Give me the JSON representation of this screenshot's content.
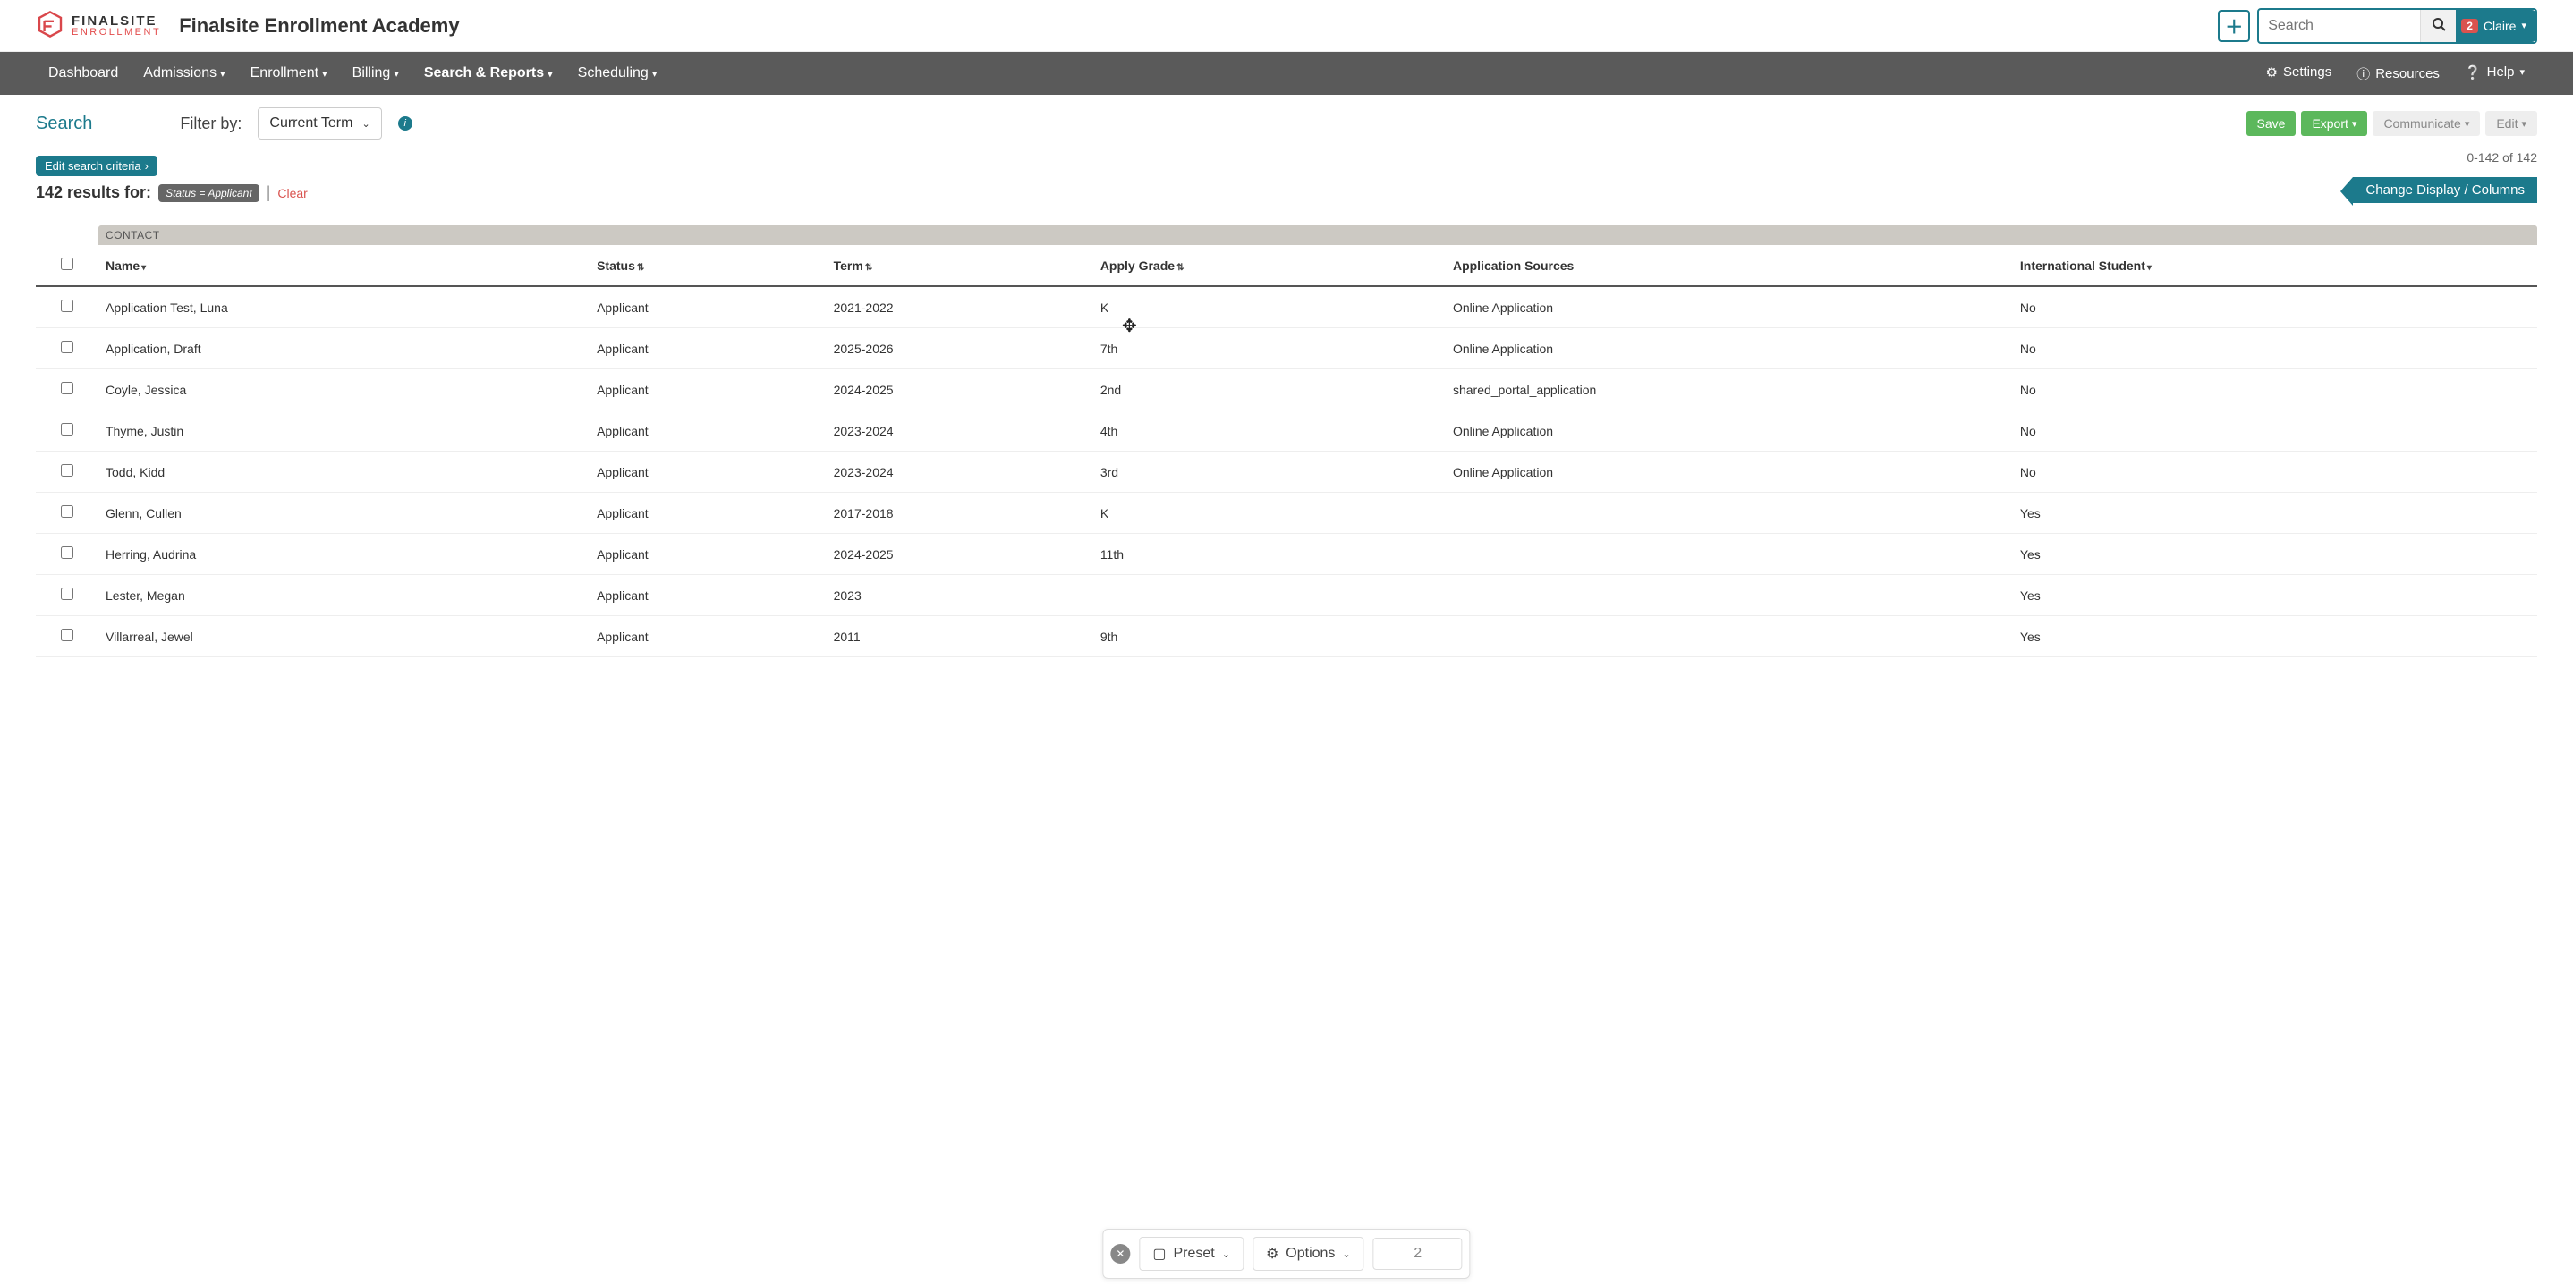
{
  "header": {
    "logo_line1": "FINALSITE",
    "logo_line2": "ENROLLMENT",
    "app_title": "Finalsite Enrollment Academy",
    "search_placeholder": "Search",
    "notif_count": "2",
    "user_name": "Claire"
  },
  "nav": {
    "items": [
      "Dashboard",
      "Admissions",
      "Enrollment",
      "Billing",
      "Search & Reports",
      "Scheduling"
    ],
    "right": [
      "Settings",
      "Resources",
      "Help"
    ]
  },
  "sub": {
    "page_label": "Search",
    "filter_label": "Filter by:",
    "filter_value": "Current Term",
    "buttons": {
      "save": "Save",
      "export": "Export",
      "communicate": "Communicate",
      "edit": "Edit"
    }
  },
  "criteria": {
    "edit_label": "Edit search criteria",
    "results_text": "142 results for:",
    "chip": "Status = Applicant",
    "clear": "Clear",
    "range": "0-142 of 142",
    "change_cols": "Change Display / Columns"
  },
  "table": {
    "group": "CONTACT",
    "columns": [
      "Name",
      "Status",
      "Term",
      "Apply Grade",
      "Application Sources",
      "International Student"
    ],
    "rows": [
      {
        "name": "Application Test, Luna",
        "status": "Applicant",
        "term": "2021-2022",
        "grade": "K",
        "source": "Online Application",
        "intl": "No"
      },
      {
        "name": "Application, Draft",
        "status": "Applicant",
        "term": "2025-2026",
        "grade": "7th",
        "source": "Online Application",
        "intl": "No"
      },
      {
        "name": "Coyle, Jessica",
        "status": "Applicant",
        "term": "2024-2025",
        "grade": "2nd",
        "source": "shared_portal_application",
        "intl": "No"
      },
      {
        "name": "Thyme, Justin",
        "status": "Applicant",
        "term": "2023-2024",
        "grade": "4th",
        "source": "Online Application",
        "intl": "No"
      },
      {
        "name": "Todd, Kidd",
        "status": "Applicant",
        "term": "2023-2024",
        "grade": "3rd",
        "source": "Online Application",
        "intl": "No"
      },
      {
        "name": "Glenn, Cullen",
        "status": "Applicant",
        "term": "2017-2018",
        "grade": "K",
        "source": "",
        "intl": "Yes"
      },
      {
        "name": "Herring, Audrina",
        "status": "Applicant",
        "term": "2024-2025",
        "grade": "11th",
        "source": "",
        "intl": "Yes"
      },
      {
        "name": "Lester, Megan",
        "status": "Applicant",
        "term": "2023",
        "grade": "",
        "source": "",
        "intl": "Yes"
      },
      {
        "name": "Villarreal, Jewel",
        "status": "Applicant",
        "term": "2011",
        "grade": "9th",
        "source": "",
        "intl": "Yes"
      }
    ]
  },
  "toolbar": {
    "preset": "Preset",
    "options": "Options",
    "page": "2"
  }
}
